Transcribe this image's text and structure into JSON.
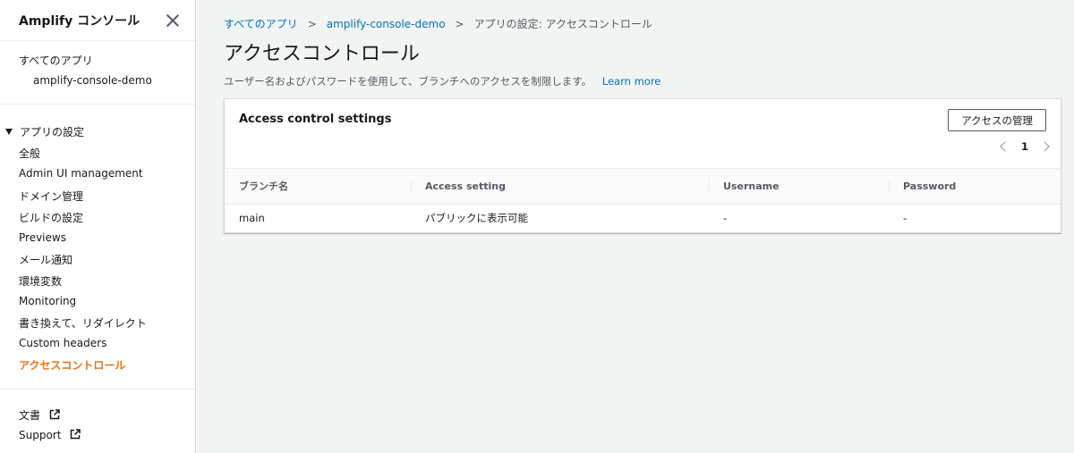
{
  "sidebar": {
    "title": "Amplify コンソール",
    "all_apps": "すべてのアプリ",
    "app_name": "amplify-console-demo",
    "section": "アプリの設定",
    "items": [
      {
        "label": "全般"
      },
      {
        "label": "Admin UI management"
      },
      {
        "label": "ドメイン管理"
      },
      {
        "label": "ビルドの設定"
      },
      {
        "label": "Previews"
      },
      {
        "label": "メール通知"
      },
      {
        "label": "環境変数"
      },
      {
        "label": "Monitoring"
      },
      {
        "label": "書き換えて、リダイレクト"
      },
      {
        "label": "Custom headers"
      },
      {
        "label": "アクセスコントロール"
      }
    ],
    "docs": "文書",
    "support": "Support"
  },
  "breadcrumb": {
    "root": "すべてのアプリ",
    "app": "amplify-console-demo",
    "current": "アプリの設定: アクセスコントロール"
  },
  "page": {
    "title": "アクセスコントロール",
    "description": "ユーザー名およびパスワードを使用して、ブランチへのアクセスを制限します。",
    "learn_more": "Learn more"
  },
  "panel": {
    "title": "Access control settings",
    "manage_button": "アクセスの管理",
    "page_number": "1"
  },
  "table": {
    "columns": [
      "ブランチ名",
      "Access setting",
      "Username",
      "Password"
    ],
    "rows": [
      {
        "branch": "main",
        "access": "パブリックに表示可能",
        "username": "-",
        "password": "-"
      }
    ]
  },
  "colors": {
    "link": "#0073bb",
    "active": "#ec7211",
    "background": "#f2f3f3"
  }
}
